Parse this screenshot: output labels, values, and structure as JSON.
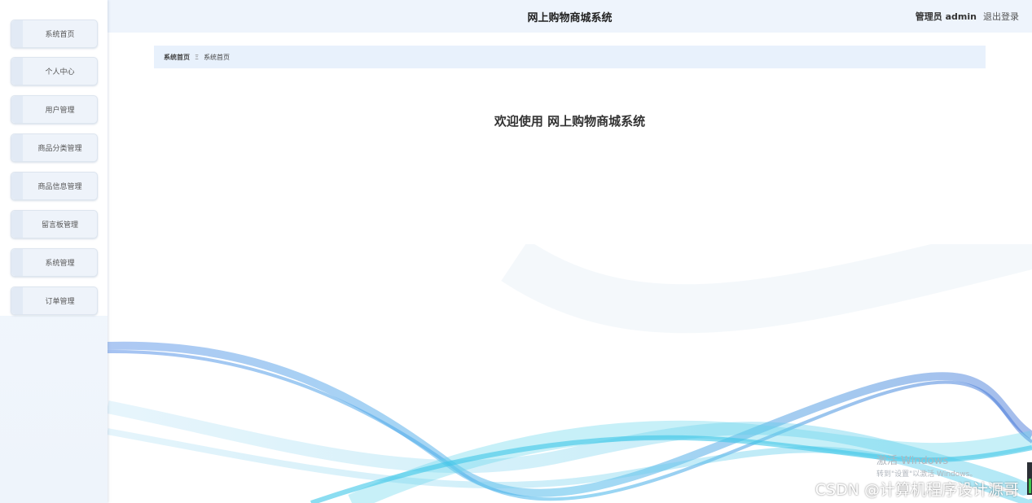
{
  "header": {
    "app_title": "网上购物商城系统",
    "user_label": "管理员 admin",
    "logout_label": "退出登录"
  },
  "sidebar": {
    "items": [
      {
        "label": "系统首页"
      },
      {
        "label": "个人中心"
      },
      {
        "label": "用户管理"
      },
      {
        "label": "商品分类管理"
      },
      {
        "label": "商品信息管理"
      },
      {
        "label": "留言板管理"
      },
      {
        "label": "系统管理"
      },
      {
        "label": "订单管理"
      }
    ]
  },
  "breadcrumb": {
    "home": "系统首页",
    "separator": "Ξ",
    "current": "系统首页"
  },
  "main": {
    "welcome_text": "欢迎使用 网上购物商城系统"
  },
  "watermarks": {
    "windows_line1": "激活 Windows",
    "windows_line2": "转到\"设置\"以激活 Windows。",
    "csdn": "CSDN @计算机程序设计源哥"
  },
  "colors": {
    "header_bg": "#eef4fc",
    "breadcrumb_bg": "#e8f1fc",
    "wave_blue": "#4a8fe0",
    "wave_cyan": "#3cc8e6"
  }
}
